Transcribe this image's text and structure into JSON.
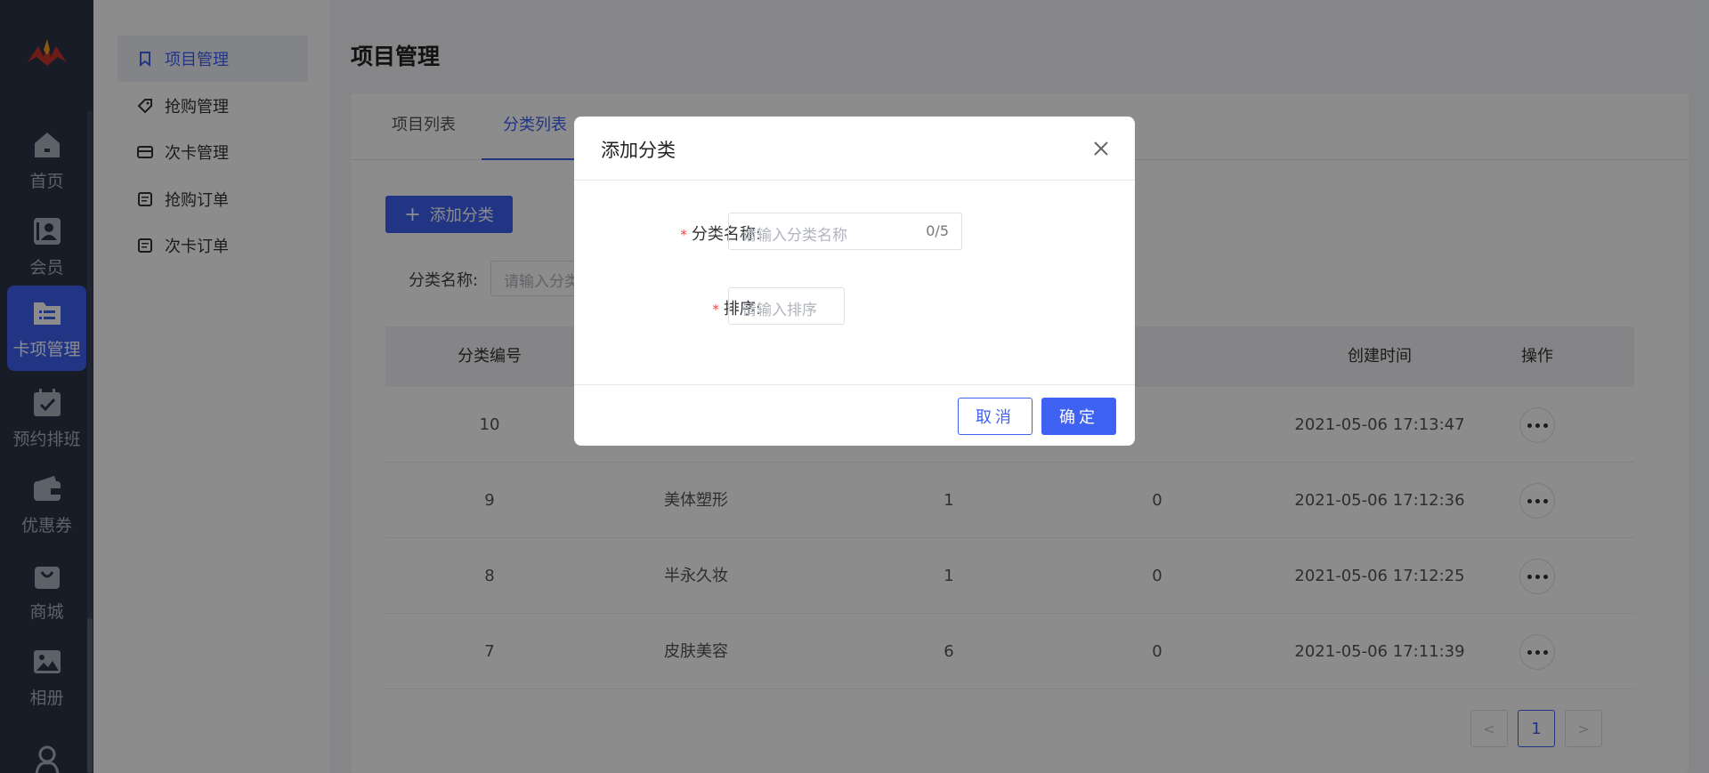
{
  "nav": {
    "items": [
      {
        "label": "首页",
        "icon": "home-icon"
      },
      {
        "label": "会员",
        "icon": "member-icon"
      },
      {
        "label": "卡项管理",
        "icon": "folder-list-icon",
        "active": true
      },
      {
        "label": "预约排班",
        "icon": "calendar-check-icon"
      },
      {
        "label": "优惠券",
        "icon": "wallet-icon"
      },
      {
        "label": "商城",
        "icon": "shopping-bag-icon"
      },
      {
        "label": "相册",
        "icon": "image-icon"
      },
      {
        "label": "",
        "icon": "people-icon"
      }
    ]
  },
  "submenu": {
    "items": [
      {
        "label": "项目管理",
        "icon": "bookmark-icon",
        "active": true
      },
      {
        "label": "抢购管理",
        "icon": "tag-icon"
      },
      {
        "label": "次卡管理",
        "icon": "card-icon"
      },
      {
        "label": "抢购订单",
        "icon": "document-icon"
      },
      {
        "label": "次卡订单",
        "icon": "document-icon"
      }
    ]
  },
  "page": {
    "title": "项目管理",
    "tabs": [
      {
        "label": "项目列表"
      },
      {
        "label": "分类列表",
        "active": true
      }
    ],
    "add_button": "添加分类",
    "filter_label": "分类名称:",
    "filter_placeholder": "请输入分类名称"
  },
  "table": {
    "headers": [
      "分类编号",
      "创建时间",
      "操作"
    ],
    "rows": [
      {
        "id": "10",
        "name": "",
        "count": "",
        "count2": "",
        "created": "2021-05-06 17:13:47"
      },
      {
        "id": "9",
        "name": "美体塑形",
        "count": "1",
        "count2": "0",
        "created": "2021-05-06 17:12:36"
      },
      {
        "id": "8",
        "name": "半永久妆",
        "count": "1",
        "count2": "0",
        "created": "2021-05-06 17:12:25"
      },
      {
        "id": "7",
        "name": "皮肤美容",
        "count": "6",
        "count2": "0",
        "created": "2021-05-06 17:11:39"
      }
    ]
  },
  "pager": {
    "prev": "<",
    "current": "1",
    "next": ">"
  },
  "modal": {
    "title": "添加分类",
    "name_label": "分类名称:",
    "name_placeholder": "请输入分类名称",
    "name_count": "0/5",
    "sort_label": "排序:",
    "sort_placeholder": "请输入排序",
    "cancel": "取消",
    "ok": "确定"
  },
  "colors": {
    "accent": "#3f62f3",
    "nav_bg": "#2a3447",
    "required": "#f04444"
  }
}
